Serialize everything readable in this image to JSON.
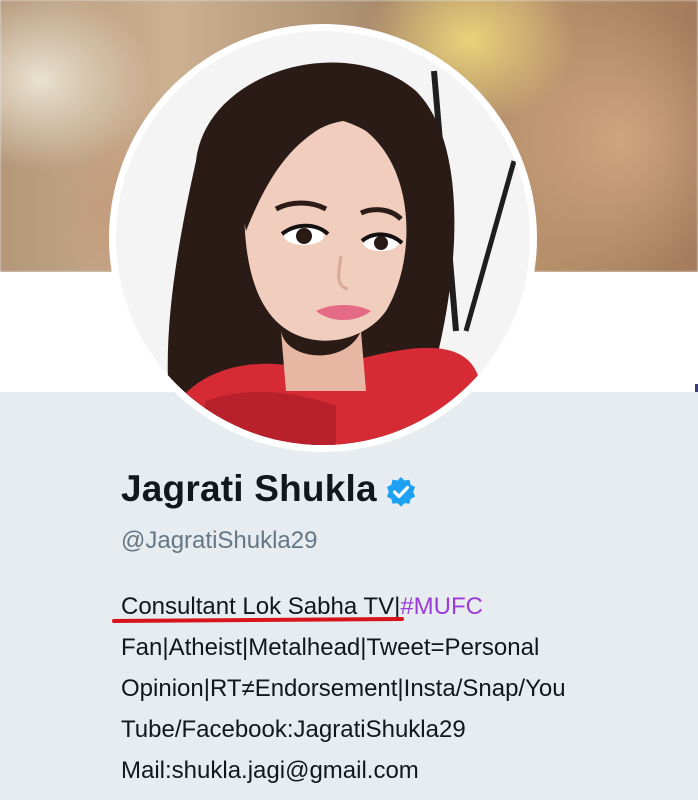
{
  "profile": {
    "display_name": "Jagrati Shukla",
    "handle": "@JagratiShukla29",
    "verified_icon": "verified-badge-icon",
    "bio_lines": [
      "Consultant Lok Sabha TV|",
      "#MUFC",
      "Fan|Atheist|Metalhead|Tweet=Personal",
      "Opinion|RT≠Endorsement|Insta/Snap/You",
      "Tube/Facebook:JagratiShukla29",
      "Mail:shukla.jagi@gmail.com"
    ]
  },
  "colors": {
    "accent_hashtag": "#9b3cd6",
    "verified_blue": "#1da1f2",
    "annotation_red": "#d8131b",
    "background": "#e6ecf0"
  }
}
